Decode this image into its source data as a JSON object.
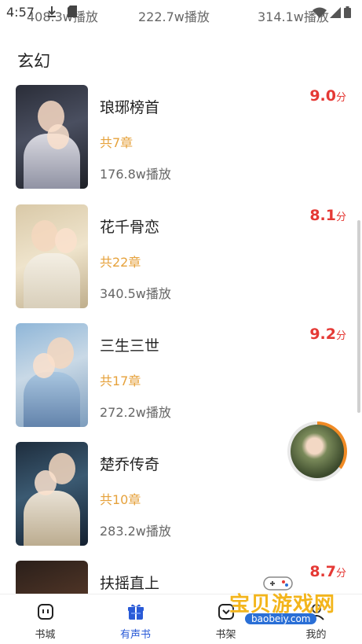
{
  "status_bar": {
    "time": "4:57"
  },
  "top_plays": [
    "408.3w播放",
    "222.7w播放",
    "314.1w播放"
  ],
  "section": {
    "title": "玄幻"
  },
  "items": [
    {
      "title": "琅琊榜首",
      "chapters": "共7章",
      "plays": "176.8w播放",
      "score": "9.0",
      "unit": "分"
    },
    {
      "title": "花千骨恋",
      "chapters": "共22章",
      "plays": "340.5w播放",
      "score": "8.1",
      "unit": "分"
    },
    {
      "title": "三生三世",
      "chapters": "共17章",
      "plays": "272.2w播放",
      "score": "9.2",
      "unit": "分"
    },
    {
      "title": "楚乔传奇",
      "chapters": "共10章",
      "plays": "283.2w播放",
      "score": "",
      "unit": ""
    },
    {
      "title": "扶摇直上",
      "chapters": "",
      "plays": "",
      "score": "8.7",
      "unit": "分"
    }
  ],
  "tabs": [
    {
      "label": "书城",
      "icon": "bookstore-icon"
    },
    {
      "label": "有声书",
      "icon": "gift-box-icon"
    },
    {
      "label": "书架",
      "icon": "bookshelf-icon"
    },
    {
      "label": "我的",
      "icon": "profile-icon"
    }
  ],
  "watermark": {
    "text": "宝贝游戏网",
    "url": "baobeiy.com"
  },
  "colors": {
    "accent": "#2a5bd7",
    "score": "#e53935",
    "chapters": "#e6a23c",
    "progress": "#f08a24"
  }
}
